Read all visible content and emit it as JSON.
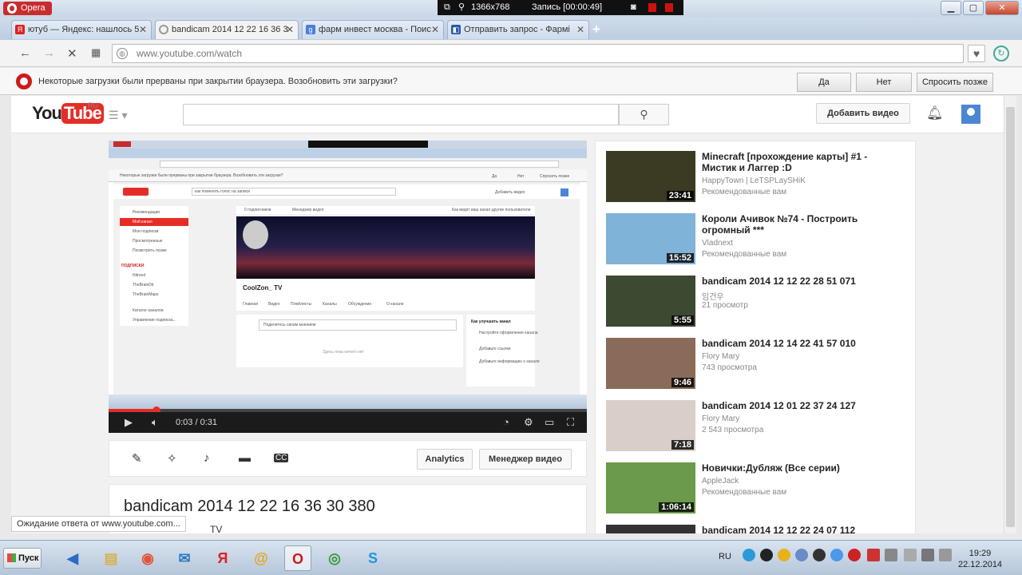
{
  "window": {
    "opera_label": "Opera",
    "recorder": {
      "resolution": "1366x768",
      "status": "Запись [00:00:49]"
    }
  },
  "tabs": [
    {
      "label": "ютуб — Яндекс: нашлось 5",
      "icon": "yandex-icon",
      "color": "#d22"
    },
    {
      "label": "bandicam 2014 12 22 16 36 3",
      "icon": "loading-icon",
      "color": "#999"
    },
    {
      "label": "фарм инвест москва - Поис",
      "icon": "google-icon",
      "color": "#4a7de0"
    },
    {
      "label": "Отправить запрос - Фармі",
      "icon": "site-icon",
      "color": "#2a5aa8"
    }
  ],
  "address": {
    "url": "www.youtube.com/watch"
  },
  "infobar": {
    "message": "Некоторые загрузки были прерваны при закрытии браузера. Возобновить эти загрузки?",
    "yes": "Да",
    "no": "Нет",
    "later": "Спросить позже"
  },
  "youtube": {
    "logo_you": "You",
    "logo_tube": "Tube",
    "logo_region": "RU",
    "upload_label": "Добавить видео",
    "player": {
      "time": "0:03 / 0:31",
      "progress": 0.1
    },
    "actions": {
      "analytics": "Analytics",
      "manager": "Менеджер видео"
    },
    "video_title": "bandicam 2014 12 22 16 36 30 380",
    "channel": "TV",
    "status_text": "Ожидание ответа от www.youtube.com...",
    "embedded": {
      "search_query": "как поменять голос на записи",
      "upload": "Добавить видео",
      "menu": [
        "Рекомендации",
        "Мой канал",
        "Мои подписки",
        "Просмотренные",
        "Посмотреть позже"
      ],
      "subs_title": "ПОДПИСКИ",
      "subs": [
        "Nitrond",
        "TheBrainDit",
        "TheBrainMaps"
      ],
      "extra": [
        "Каталог каналов",
        "Управление подписка..."
      ],
      "channel_name": "CoolZon_ TV",
      "channel_tabs": [
        "Главная",
        "Видео",
        "Плейлисты",
        "Каналы",
        "Обсуждение",
        "О канале"
      ],
      "comment_placeholder": "Поделитесь своим мнением",
      "empty": "Здесь пока ничего нет",
      "improve_title": "Как улучшить канал",
      "tips": [
        "Настройте оформление канала",
        "Добавьте ссылки",
        "Добавьте информацию о канале"
      ],
      "top_links": [
        "0 подписчиков",
        "Менеджер видео",
        "Как видят ваш канал другие пользователи"
      ],
      "infobar": "Некоторые загрузки были прерваны при закрытии браузера. Возобновить эти загрузки?",
      "btn_yes": "Да",
      "btn_no": "Нет",
      "btn_later": "Спросить позже"
    },
    "recommendations": [
      {
        "title": "Minecraft [прохождение карты] #1 - Мистик и Лаггер :D",
        "author": "HappyTown | LeTSPLaySHiK",
        "meta": "Рекомендованные вам",
        "duration": "23:41",
        "bg": "#3b3a22"
      },
      {
        "title": "Короли Ачивок №74 - Построить огромный ***",
        "author": "Vladnext",
        "meta": "Рекомендованные вам",
        "duration": "15:52",
        "bg": "#7fb3d8"
      },
      {
        "title": "bandicam 2014 12 12 22 28 51 071",
        "author": "임건우",
        "meta": "21 просмотр",
        "duration": "5:55",
        "bg": "#3c4a32"
      },
      {
        "title": "bandicam 2014 12 14 22 41 57 010",
        "author": "Flory Mary",
        "meta": "743 просмотра",
        "duration": "9:46",
        "bg": "#8a6b5a"
      },
      {
        "title": "bandicam 2014 12 01 22 37 24 127",
        "author": "Flory Mary",
        "meta": "2 543 просмотра",
        "duration": "7:18",
        "bg": "#d9cfc8"
      },
      {
        "title": "Новички:Дубляж (Все серии)",
        "author": "AppleJack",
        "meta": "Рекомендованные вам",
        "duration": "1:06:14",
        "bg": "#6a9a4a"
      },
      {
        "title": "bandicam 2014 12 12 22 24 07 112",
        "author": "",
        "meta": "",
        "duration": "",
        "bg": "#333"
      }
    ]
  },
  "taskbar": {
    "start": "Пуск",
    "lang": "RU",
    "time": "19:29",
    "date": "22.12.2014"
  }
}
